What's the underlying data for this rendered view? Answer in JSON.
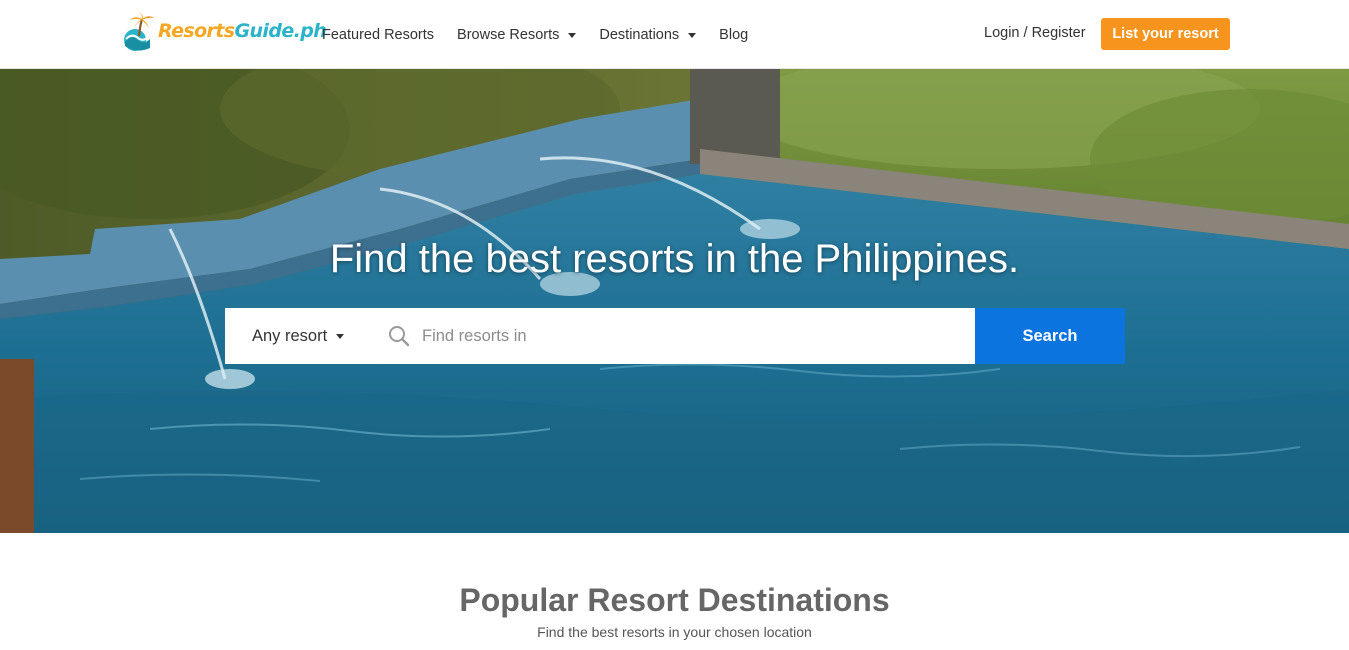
{
  "brand": {
    "logo_text_a": "Resorts",
    "logo_text_b": "Guide.ph",
    "logo_icon": "palm-tree-wave-icon",
    "colors": {
      "orange": "#f7941d",
      "teal": "#2bb4c9",
      "blue": "#0b74de"
    }
  },
  "nav": {
    "items": [
      {
        "label": "Featured Resorts",
        "dropdown": false
      },
      {
        "label": "Browse Resorts",
        "dropdown": true
      },
      {
        "label": "Destinations",
        "dropdown": true
      },
      {
        "label": "Blog",
        "dropdown": false
      }
    ],
    "login_label": "Login / Register",
    "list_button": "List your resort"
  },
  "hero": {
    "title": "Find the best resorts in the Philippines.",
    "search": {
      "type_select": "Any resort",
      "placeholder": "Find resorts in",
      "button": "Search",
      "icon": "search-icon"
    }
  },
  "section": {
    "title": "Popular Resort Destinations",
    "subtitle": "Find the best resorts in your chosen location"
  }
}
